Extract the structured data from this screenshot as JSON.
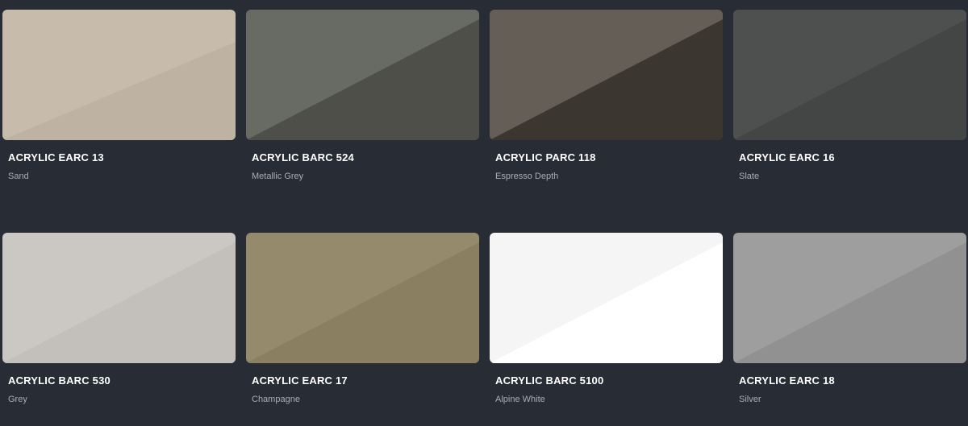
{
  "swatches": [
    {
      "code": "ACRYLIC EARC 13",
      "name": "Sand",
      "color_light": "#c7bcab",
      "color_dark": "#beb3a2"
    },
    {
      "code": "ACRYLIC BARC 524",
      "name": "Metallic Grey",
      "color_light": "#686a64",
      "color_dark": "#4d4f48"
    },
    {
      "code": "ACRYLIC PARC 118",
      "name": "Espresso Depth",
      "color_light": "#645e56",
      "color_dark": "#3b3630"
    },
    {
      "code": "ACRYLIC EARC 16",
      "name": "Slate",
      "color_light": "#4e504f",
      "color_dark": "#444545"
    },
    {
      "code": "ACRYLIC BARC 530",
      "name": "Grey",
      "color_light": "#cbc8c4",
      "color_dark": "#c3c0bb"
    },
    {
      "code": "ACRYLIC EARC 17",
      "name": "Champagne",
      "color_light": "#968a6d",
      "color_dark": "#8a7f60"
    },
    {
      "code": "ACRYLIC BARC 5100",
      "name": "Alpine White",
      "color_light": "#f5f5f5",
      "color_dark": "#ffffff"
    },
    {
      "code": "ACRYLIC EARC 18",
      "name": "Silver",
      "color_light": "#9e9e9e",
      "color_dark": "#919191"
    }
  ]
}
